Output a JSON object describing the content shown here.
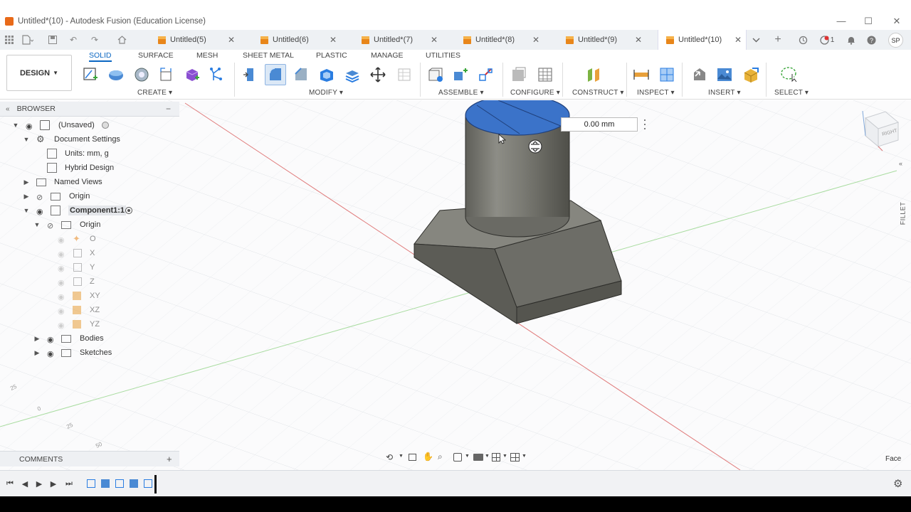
{
  "window": {
    "title": "Untitled*(10) - Autodesk Fusion (Education License)",
    "minimize": "—",
    "maximize": "☐",
    "close": "✕"
  },
  "tabs": [
    {
      "label": "Untitled(5)",
      "active": false
    },
    {
      "label": "Untitled(6)",
      "active": false
    },
    {
      "label": "Untitled*(7)",
      "active": false
    },
    {
      "label": "Untitled*(8)",
      "active": false
    },
    {
      "label": "Untitled*(9)",
      "active": false
    },
    {
      "label": "Untitled*(10)",
      "active": true
    }
  ],
  "tabbar_right": {
    "notifications_count": "1",
    "user_initials": "SP"
  },
  "ribbon": {
    "workspace": "DESIGN",
    "tabs": [
      "SOLID",
      "SURFACE",
      "MESH",
      "SHEET METAL",
      "PLASTIC",
      "MANAGE",
      "UTILITIES"
    ],
    "active_tab": "SOLID",
    "groups": {
      "create": "CREATE",
      "modify": "MODIFY",
      "assemble": "ASSEMBLE",
      "configure": "CONFIGURE",
      "construct": "CONSTRUCT",
      "inspect": "INSPECT",
      "insert": "INSERT",
      "select": "SELECT"
    }
  },
  "browser": {
    "title": "BROWSER",
    "items": [
      {
        "label": "(Unsaved)"
      },
      {
        "label": "Document Settings"
      },
      {
        "label": "Units: mm, g"
      },
      {
        "label": "Hybrid Design"
      },
      {
        "label": "Named Views"
      },
      {
        "label": "Origin"
      },
      {
        "label": "Component1:1"
      },
      {
        "label": "Origin"
      },
      {
        "label": "O"
      },
      {
        "label": "X"
      },
      {
        "label": "Y"
      },
      {
        "label": "Z"
      },
      {
        "label": "XY"
      },
      {
        "label": "XZ"
      },
      {
        "label": "YZ"
      },
      {
        "label": "Bodies"
      },
      {
        "label": "Sketches"
      }
    ]
  },
  "viewport": {
    "dimension_value": "0.00 mm",
    "fillet_panel_label": "FILLET",
    "selection_status": "Face",
    "viewcube_face": "RIGHT",
    "grid_labels": [
      "25",
      "0",
      "25",
      "50"
    ]
  },
  "comments": {
    "title": "COMMENTS"
  },
  "colors": {
    "accent": "#0a66c2",
    "selected_face": "#3b73c9",
    "body_gray": "#76766f",
    "tab_cube": "#e8861a"
  }
}
